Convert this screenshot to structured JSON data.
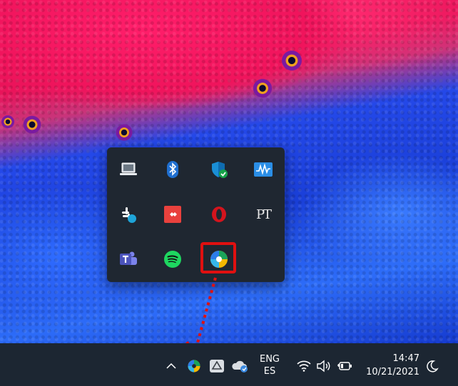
{
  "flyout": {
    "icons": [
      {
        "icon": "laptop-icon",
        "label": ""
      },
      {
        "icon": "bluetooth-icon",
        "label": ""
      },
      {
        "icon": "windows-security-icon",
        "label": ""
      },
      {
        "icon": "audio-meter-icon",
        "label": ""
      },
      {
        "icon": "slack-icon",
        "label": ""
      },
      {
        "icon": "anydesk-icon",
        "label": ""
      },
      {
        "icon": "opera-icon",
        "label": ""
      },
      {
        "icon": "pt-icon",
        "label": "PT"
      },
      {
        "icon": "teams-icon",
        "label": ""
      },
      {
        "icon": "spotify-icon",
        "label": ""
      },
      {
        "icon": "edge-canary-icon",
        "label": ""
      }
    ]
  },
  "taskbar": {
    "chevron_icon": "chevron-up-icon",
    "tray": [
      "edge-canary-icon",
      "google-drive-icon",
      "onedrive-icon"
    ],
    "language": {
      "line1": "ENG",
      "line2": "ES"
    },
    "system": [
      "wifi-icon",
      "volume-icon",
      "battery-icon"
    ],
    "clock": {
      "time": "14:47",
      "date": "10/21/2021"
    },
    "focus_icon": "moon-icon"
  },
  "colors": {
    "taskbar_bg": "#1c2632",
    "flyout_bg": "#1f2731",
    "highlight": "#e01010",
    "wallpaper_pink": "#e9145a",
    "wallpaper_blue": "#1a3fd8"
  }
}
